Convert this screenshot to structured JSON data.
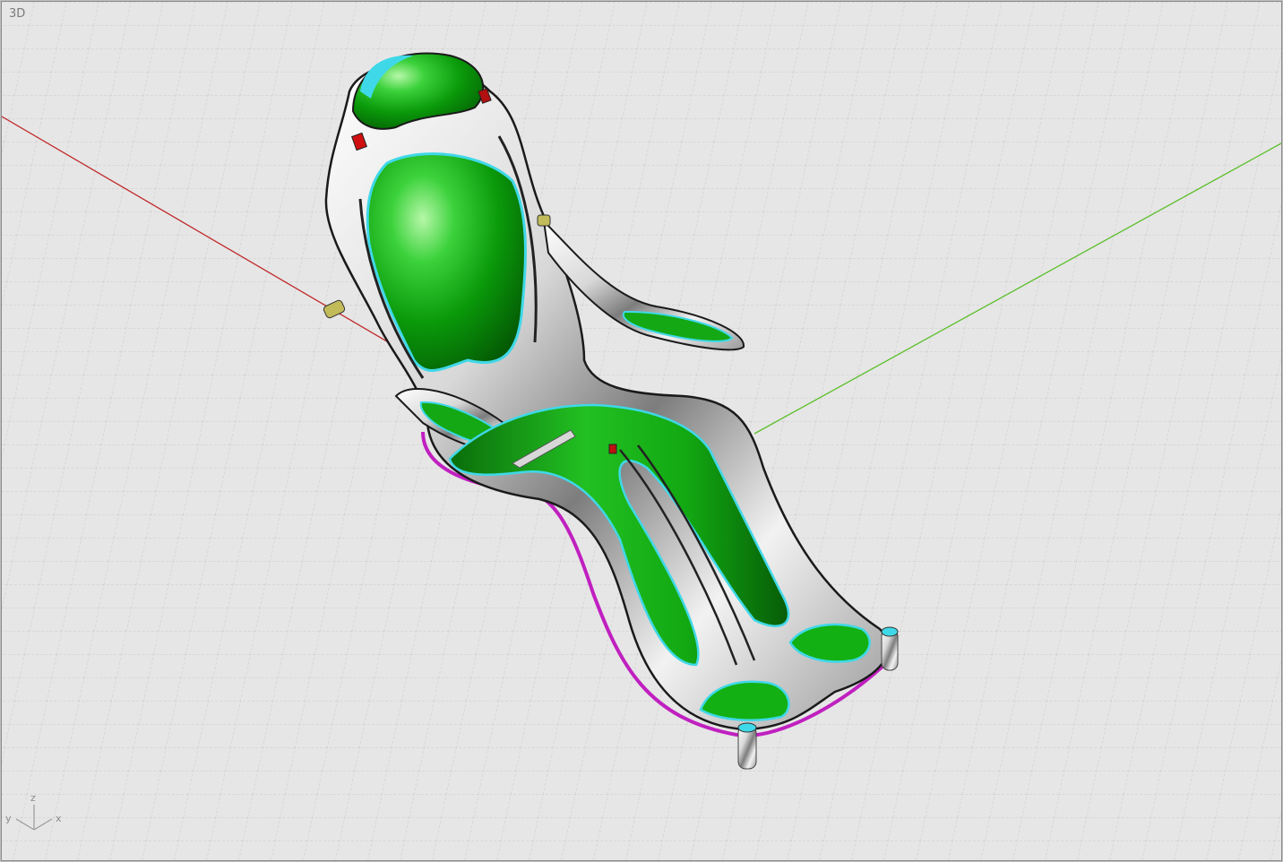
{
  "viewport": {
    "title": "3D"
  },
  "axis_widget": {
    "x_label": "x",
    "y_label": "y",
    "z_label": "z"
  },
  "colors": {
    "background": "#e6e6e6",
    "grid_minor": "#c9c9c9",
    "grid_major": "#b4b4b4",
    "x_axis": "#c0282a",
    "y_axis": "#5cbf2a",
    "seat_green": "#12a812",
    "seat_trim": "#3fd8e8",
    "frame_edge": "#c020c0"
  }
}
